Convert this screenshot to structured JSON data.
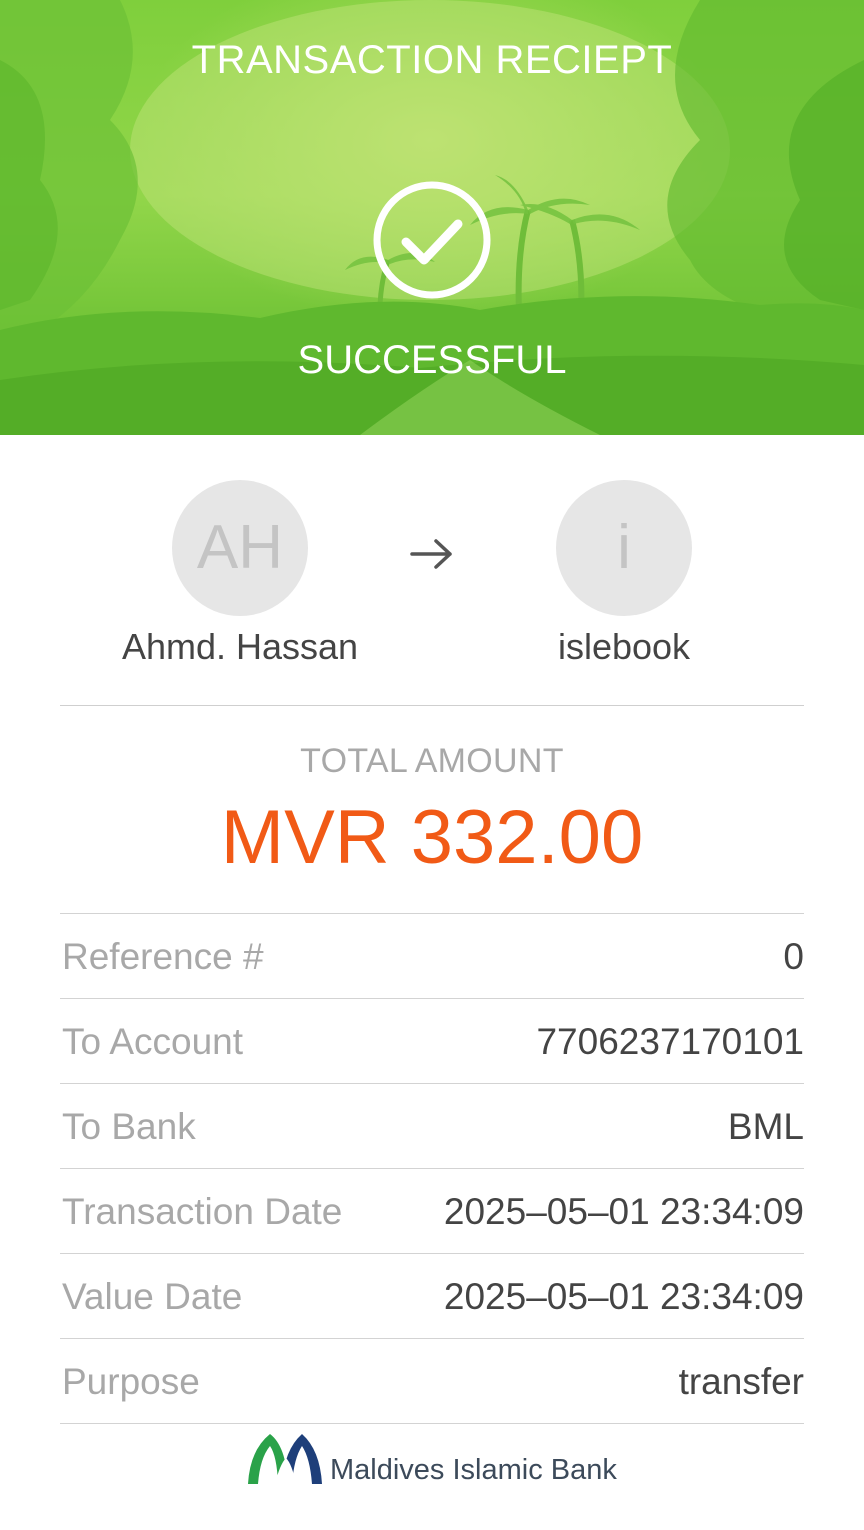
{
  "header": {
    "title": "TRANSACTION RECIEPT",
    "status": "SUCCESSFUL",
    "status_icon": "check-circle-icon"
  },
  "sender": {
    "initials": "AH",
    "name": "Ahmd. Hassan"
  },
  "receiver": {
    "initials": "i",
    "name": "islebook"
  },
  "transfer_icon": "arrow-right-icon",
  "total": {
    "label": "TOTAL AMOUNT",
    "amount": "MVR 332.00",
    "color": "#f15a16"
  },
  "details": [
    {
      "label": "Reference #",
      "value": "0"
    },
    {
      "label": "To Account",
      "value": "7706237170101"
    },
    {
      "label": "To Bank",
      "value": "BML"
    },
    {
      "label": "Transaction Date",
      "value": "2025–05–01 23:34:09"
    },
    {
      "label": "Value Date",
      "value": "2025–05–01 23:34:09"
    },
    {
      "label": "Purpose",
      "value": "transfer"
    }
  ],
  "footer": {
    "bank_name": "Maldives Islamic Bank",
    "logo_icon": "bank-logo-icon"
  },
  "colors": {
    "header_green": "#7fcf3c",
    "accent_orange": "#f15a16",
    "logo_green": "#2aa249",
    "logo_navy": "#1e3f7a"
  }
}
